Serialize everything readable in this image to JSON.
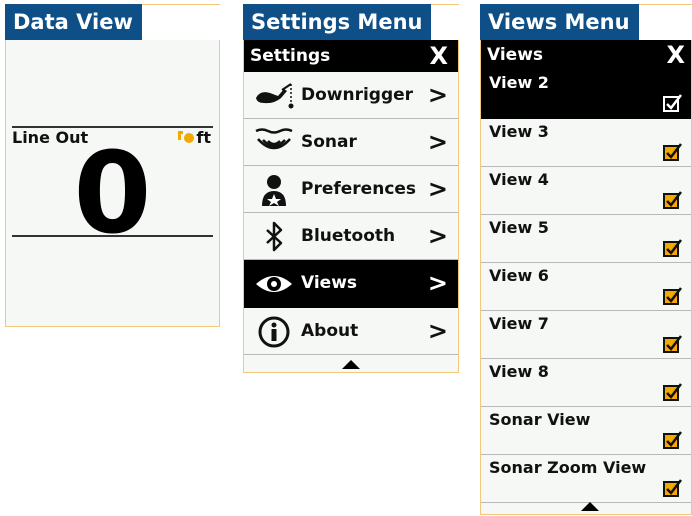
{
  "data_view": {
    "title": "Data View",
    "label": "Line Out",
    "unit": "ft",
    "value": "0",
    "unit_icon": "downrigger-ball-icon",
    "accent": "#f5a800"
  },
  "settings_menu": {
    "title": "Settings Menu",
    "header": "Settings",
    "close_label": "X",
    "chevron": ">",
    "items": [
      {
        "label": "Downrigger",
        "icon": "downrigger-icon"
      },
      {
        "label": "Sonar",
        "icon": "sonar-icon"
      },
      {
        "label": "Preferences",
        "icon": "preferences-icon"
      },
      {
        "label": "Bluetooth",
        "icon": "bluetooth-icon"
      },
      {
        "label": "Views",
        "icon": "eye-icon",
        "selected": true
      },
      {
        "label": "About",
        "icon": "info-icon"
      }
    ]
  },
  "views_menu": {
    "title": "Views Menu",
    "header": "Views",
    "close_label": "X",
    "check_color": "#f5a800",
    "items": [
      {
        "label": "View 2",
        "selected": true,
        "checked": true
      },
      {
        "label": "View 3",
        "checked": true
      },
      {
        "label": "View 4",
        "checked": true
      },
      {
        "label": "View 5",
        "checked": true
      },
      {
        "label": "View 6",
        "checked": true
      },
      {
        "label": "View 7",
        "checked": true
      },
      {
        "label": "View 8",
        "checked": true
      },
      {
        "label": "Sonar View",
        "checked": true
      },
      {
        "label": "Sonar Zoom View",
        "checked": true
      }
    ]
  },
  "colors": {
    "title_bar": "#0e4f87",
    "panel_border": "#f3c77c",
    "panel_bg": "#f6f8f5",
    "selected_bg": "#000000"
  }
}
